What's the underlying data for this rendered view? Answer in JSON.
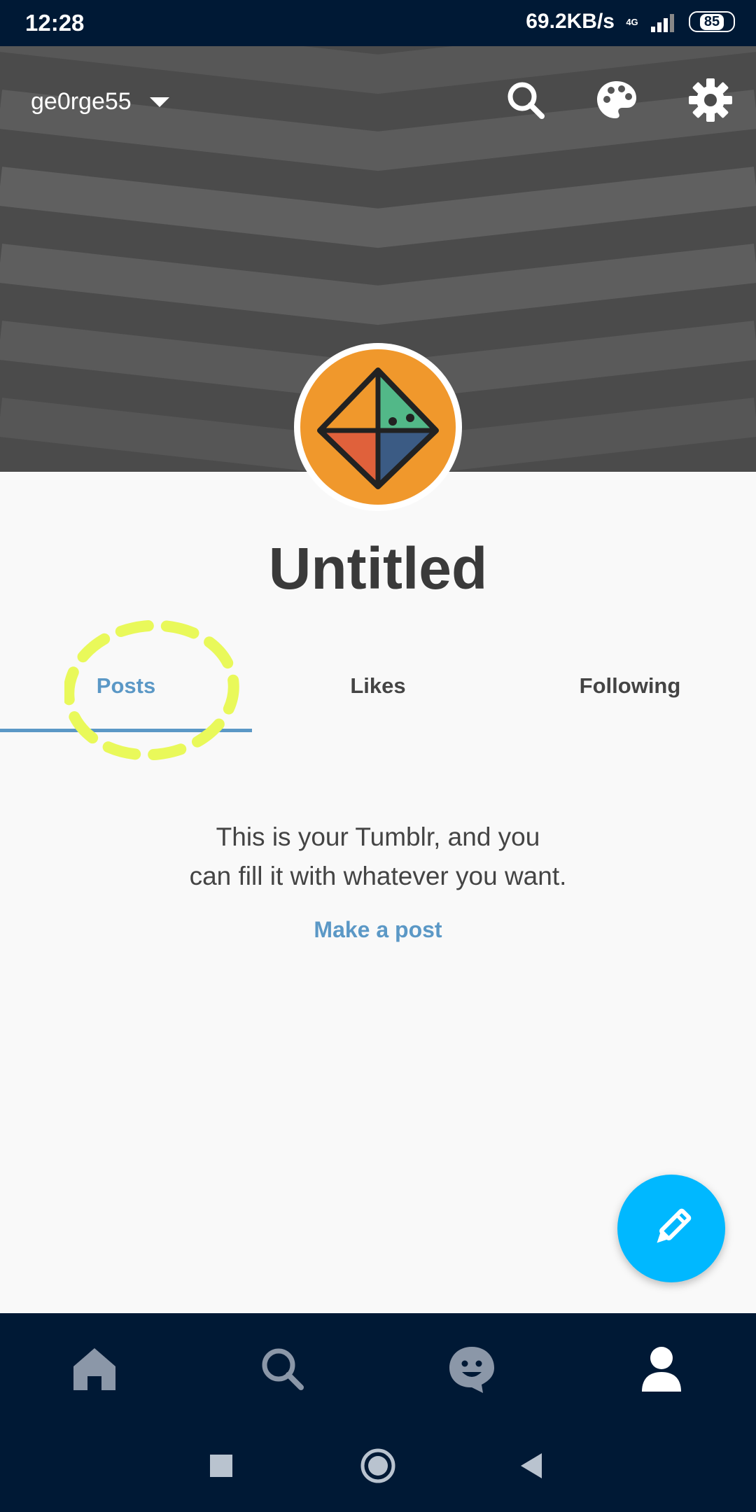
{
  "status_bar": {
    "time": "12:28",
    "speed": "69.2KB/s",
    "network": "4G",
    "battery": "85"
  },
  "header": {
    "blog_name": "ge0rge55",
    "icons": [
      "search-icon",
      "palette-icon",
      "gear-icon"
    ]
  },
  "blog": {
    "title": "Untitled"
  },
  "tabs": [
    {
      "label": "Posts",
      "active": true
    },
    {
      "label": "Likes",
      "active": false
    },
    {
      "label": "Following",
      "active": false
    }
  ],
  "empty_state": {
    "line1": "This is your Tumblr, and you",
    "line2": "can fill it with whatever you want.",
    "action": "Make a post"
  },
  "bottom_nav": [
    "home-icon",
    "search-icon",
    "chat-icon",
    "account-icon"
  ],
  "colors": {
    "accent": "#5b98c6",
    "fab": "#00b8ff",
    "nav_bg": "#001935",
    "avatar_bg": "#f0982c",
    "highlight": "#e9f95a"
  }
}
